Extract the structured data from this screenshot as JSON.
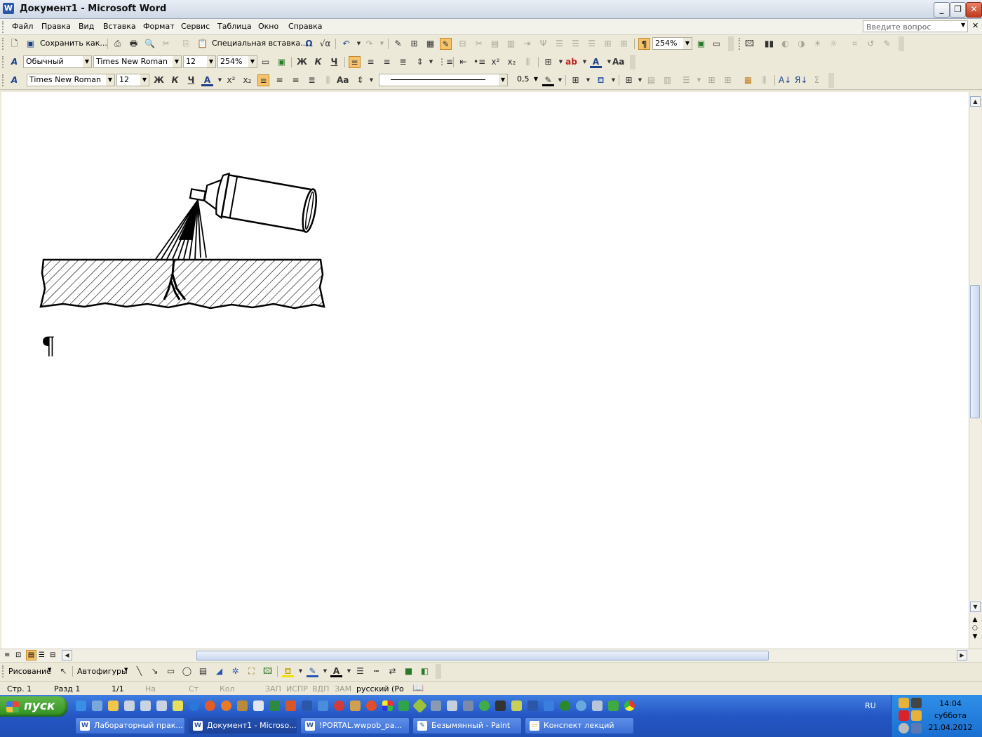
{
  "window": {
    "title": "Документ1 - Microsoft Word",
    "app_icon": "W",
    "minimize": "_",
    "maximize": "❐",
    "close": "✕"
  },
  "menu": {
    "items": [
      "Файл",
      "Правка",
      "Вид",
      "Вставка",
      "Формат",
      "Сервис",
      "Таблица",
      "Окно",
      "Справка"
    ],
    "ask_placeholder": "Введите вопрос"
  },
  "toolbar_standard": {
    "save_as": "Сохранить как...",
    "paste_special": "Специальная вставка...",
    "zoom": "254%"
  },
  "toolbar_formatting": {
    "style": "Обычный",
    "font": "Times New Roman",
    "size": "12",
    "zoom": "254%",
    "bold": "Ж",
    "italic": "К",
    "underline": "Ч",
    "font_color": "A",
    "caps": "Aa"
  },
  "toolbar_drawing_fmt": {
    "font": "Times New Roman",
    "size": "12",
    "line_width": "0,5",
    "bold": "Ж",
    "italic": "К",
    "underline": "Ч",
    "font_color": "A",
    "caps": "Aa",
    "sigma": "Σ"
  },
  "document": {
    "pilcrow": "¶"
  },
  "drawing_toolbar": {
    "drawing": "Рисование",
    "autoshapes": "Автофигуры",
    "font_color": "A"
  },
  "status": {
    "page": "Стр. 1",
    "section": "Разд 1",
    "pages": "1/1",
    "at": "На",
    "line": "Ст",
    "col": "Кол",
    "rec": "ЗАП",
    "trk": "ИСПР",
    "ext": "ВДП",
    "ovr": "ЗАМ",
    "language": "русский (Ро"
  },
  "taskbar": {
    "start": "пуск",
    "buttons": [
      {
        "label": "Лабораторный прак...",
        "icon": "W"
      },
      {
        "label": "Документ1 - Microso...",
        "icon": "W"
      },
      {
        "label": "!PORTAL.wwpob_pa...",
        "icon": "W"
      },
      {
        "label": "Безымянный - Paint",
        "icon": "✎"
      },
      {
        "label": "Конспект лекций",
        "icon": "▭"
      }
    ],
    "lang": "RU",
    "time": "14:04",
    "weekday": "суббота",
    "date": "21.04.2012"
  }
}
